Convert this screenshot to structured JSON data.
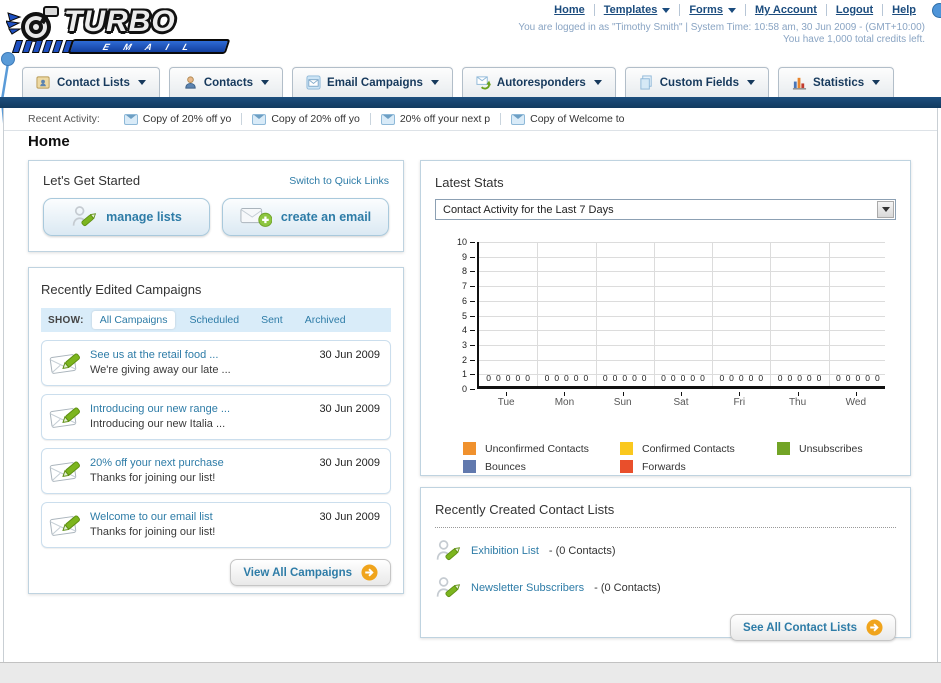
{
  "brand": {
    "name_top": "TURBO",
    "name_bottom": "E M A I L"
  },
  "header": {
    "nav": [
      {
        "label": "Home",
        "dropdown": false
      },
      {
        "label": "Templates",
        "dropdown": true
      },
      {
        "label": "Forms",
        "dropdown": true
      },
      {
        "label": "My Account",
        "dropdown": false
      },
      {
        "label": "Logout",
        "dropdown": false
      },
      {
        "label": "Help",
        "dropdown": false
      }
    ],
    "login_info": "You are logged in as \"Timothy Smith\" | System Time: 10:58 am, 30 Jun 2009 - (GMT+10:00)",
    "credits_info": "You have 1,000 total credits left."
  },
  "tabs": [
    {
      "label": "Contact Lists"
    },
    {
      "label": "Contacts"
    },
    {
      "label": "Email Campaigns"
    },
    {
      "label": "Autoresponders"
    },
    {
      "label": "Custom Fields"
    },
    {
      "label": "Statistics"
    }
  ],
  "recent_activity": {
    "label": "Recent Activity:",
    "items": [
      "Copy of 20% off yo",
      "Copy of 20% off yo",
      "20% off your next p",
      "Copy of Welcome to"
    ]
  },
  "page_title": "Home",
  "get_started": {
    "title": "Let's Get Started",
    "switch_link": "Switch to Quick Links",
    "buttons": [
      {
        "label": "manage lists"
      },
      {
        "label": "create an email"
      }
    ]
  },
  "campaigns": {
    "title": "Recently Edited Campaigns",
    "show_label": "SHOW:",
    "filters": [
      "All Campaigns",
      "Scheduled",
      "Sent",
      "Archived"
    ],
    "active_filter": "All Campaigns",
    "items": [
      {
        "title": "See us at the retail food ...",
        "subtitle": "We're giving away our late ...",
        "date": "30 Jun 2009"
      },
      {
        "title": "Introducing our new range ...",
        "subtitle": "Introducing our new Italia ...",
        "date": "30 Jun 2009"
      },
      {
        "title": "20% off your next purchase",
        "subtitle": "Thanks for joining our list!",
        "date": "30 Jun 2009"
      },
      {
        "title": "Welcome to our email list",
        "subtitle": "Thanks for joining our list!",
        "date": "30 Jun 2009"
      }
    ],
    "view_all": "View All Campaigns"
  },
  "stats": {
    "title": "Latest Stats",
    "dropdown_value": "Contact Activity for the Last 7 Days"
  },
  "chart_data": {
    "type": "bar",
    "title": "Contact Activity for the Last 7 Days",
    "categories": [
      "Tue",
      "Mon",
      "Sun",
      "Sat",
      "Fri",
      "Thu",
      "Wed"
    ],
    "series": [
      {
        "name": "Unconfirmed Contacts",
        "color": "#F0912D",
        "values": [
          0,
          0,
          0,
          0,
          0,
          0,
          0
        ]
      },
      {
        "name": "Confirmed Contacts",
        "color": "#FAC81E",
        "values": [
          0,
          0,
          0,
          0,
          0,
          0,
          0
        ]
      },
      {
        "name": "Unsubscribes",
        "color": "#72A426",
        "values": [
          0,
          0,
          0,
          0,
          0,
          0,
          0
        ]
      },
      {
        "name": "Bounces",
        "color": "#6179AE",
        "values": [
          0,
          0,
          0,
          0,
          0,
          0,
          0
        ]
      },
      {
        "name": "Forwards",
        "color": "#E94F2B",
        "values": [
          0,
          0,
          0,
          0,
          0,
          0,
          0
        ]
      }
    ],
    "ylim": [
      0,
      10
    ],
    "ytick_step": 1,
    "grid": true,
    "legend_position": "bottom",
    "value_labels_shown": true
  },
  "contact_lists": {
    "title": "Recently Created Contact Lists",
    "items": [
      {
        "name": "Exhibition List",
        "suffix": "- (0 Contacts)"
      },
      {
        "name": "Newsletter Subscribers",
        "suffix": "- (0 Contacts)"
      }
    ],
    "see_all": "See All Contact Lists"
  },
  "colors": {
    "navy_bar": "#15436E",
    "header_link": "#1B4C7E",
    "muted_blue_text": "#89A4C3",
    "teal_link": "#2E7CA7",
    "show_bar_bg": "#D9ECF9",
    "orange_arrow": "#F0A41C"
  }
}
